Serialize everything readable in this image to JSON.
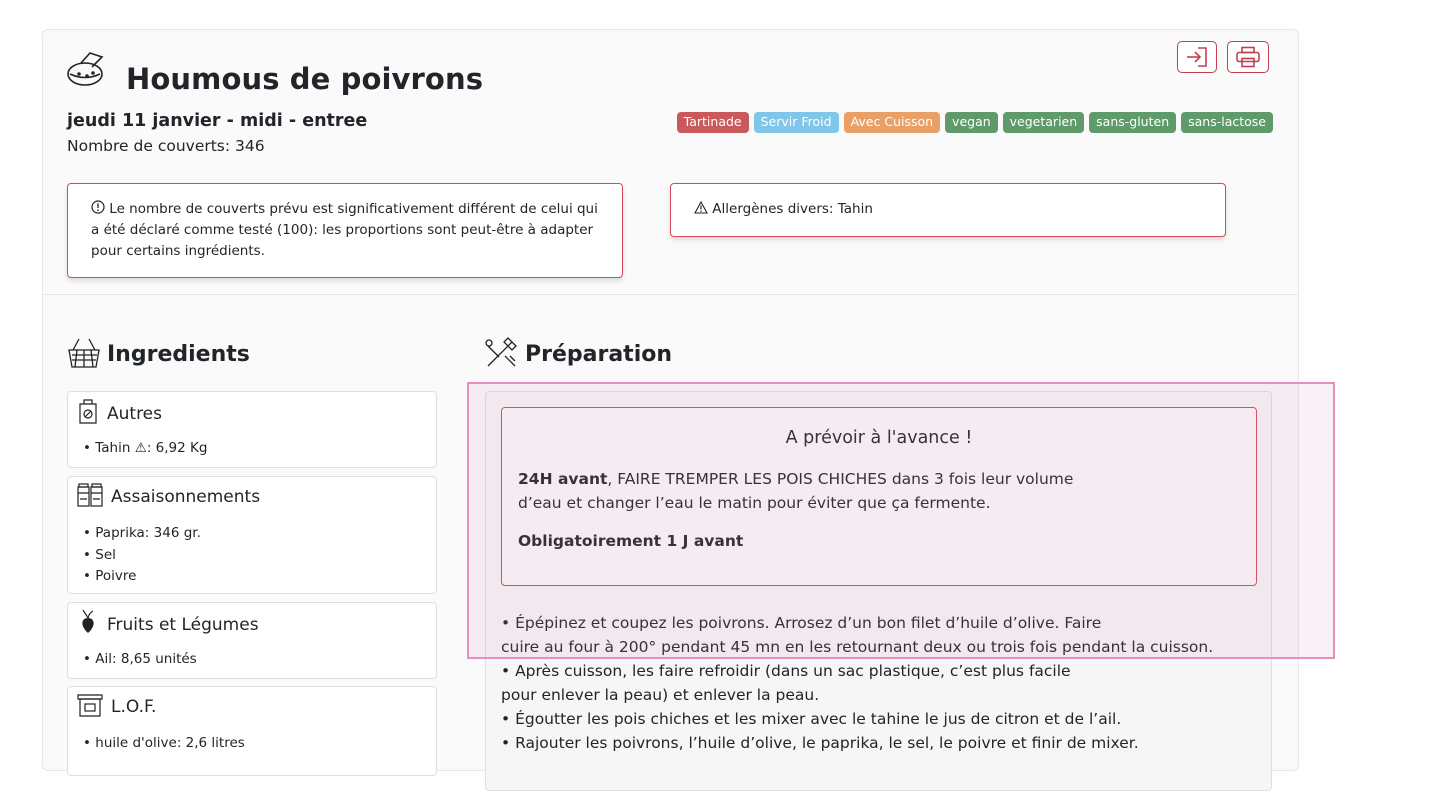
{
  "recipe": {
    "title": "Houmous de poivrons",
    "date_line": "jeudi 11 janvier - midi - entree",
    "covers": "Nombre de couverts: 346"
  },
  "tags": [
    {
      "label": "Tartinade",
      "color": "#c9595b"
    },
    {
      "label": "Servir Froid",
      "color": "#7fc6e8"
    },
    {
      "label": "Avec Cuisson",
      "color": "#e9a066"
    },
    {
      "label": "vegan",
      "color": "#5f9a6a"
    },
    {
      "label": "vegetarien",
      "color": "#5f9a6a"
    },
    {
      "label": "sans-gluten",
      "color": "#5f9a6a"
    },
    {
      "label": "sans-lactose",
      "color": "#5f9a6a"
    }
  ],
  "alerts": {
    "covers_warning": {
      "icon": "info-circle-icon",
      "text": "Le nombre de couverts prévu est significativement différent de celui qui a été déclaré comme testé (100): les proportions sont peut-être à adapter pour certains ingrédients."
    },
    "allergens": {
      "icon": "warning-triangle-icon",
      "label": "Allergènes divers:",
      "value": "Tahin"
    }
  },
  "ingredients": {
    "heading": "Ingredients",
    "groups": [
      {
        "name": "Autres",
        "icon": "bag-icon",
        "items": [
          {
            "name": "Tahin",
            "warning": "⚠",
            "qty": ": 6,92 Kg"
          }
        ]
      },
      {
        "name": "Assaisonnements",
        "icon": "spice-jars-icon",
        "items": [
          {
            "name": "Paprika",
            "qty": ": 346 gr."
          },
          {
            "name": "Sel",
            "qty": ""
          },
          {
            "name": "Poivre",
            "qty": ""
          }
        ]
      },
      {
        "name": "Fruits et Légumes",
        "icon": "beet-icon",
        "items": [
          {
            "name": "Ail",
            "qty": ": 8,65 unités"
          }
        ]
      },
      {
        "name": "L.O.F.",
        "icon": "jar-icon",
        "items": [
          {
            "name": "huile d'olive",
            "qty": ": 2,6 litres"
          }
        ]
      }
    ]
  },
  "preparation": {
    "heading": "Préparation",
    "advance": {
      "title": "A prévoir à l'avance !",
      "p1_bold": "24H avant",
      "p1_line1": ", FAIRE TREMPER LES POIS CHICHES dans 3 fois leur volume",
      "p1_line2": "d’eau et changer l’eau le matin pour éviter que ça fermente.",
      "p2": "Obligatoirement 1 J avant"
    },
    "steps": [
      "• Épépinez et coupez les poivrons. Arrosez d’un bon filet d’huile d’olive. Faire",
      "cuire au four à 200° pendant 45 mn en les retournant deux ou trois fois pendant la cuisson.",
      "• Après cuisson, les faire refroidir (dans un sac plastique, c’est plus facile",
      "pour enlever la peau) et enlever la peau.",
      "• Égoutter les pois chiches et les mixer avec le tahine le jus de citron et de l’ail.",
      "• Rajouter les poivrons, l’huile d’olive, le paprika, le sel, le poivre et finir de mixer."
    ]
  },
  "toolbar": {
    "export_icon": "sign-in-icon",
    "print_icon": "printer-icon"
  }
}
